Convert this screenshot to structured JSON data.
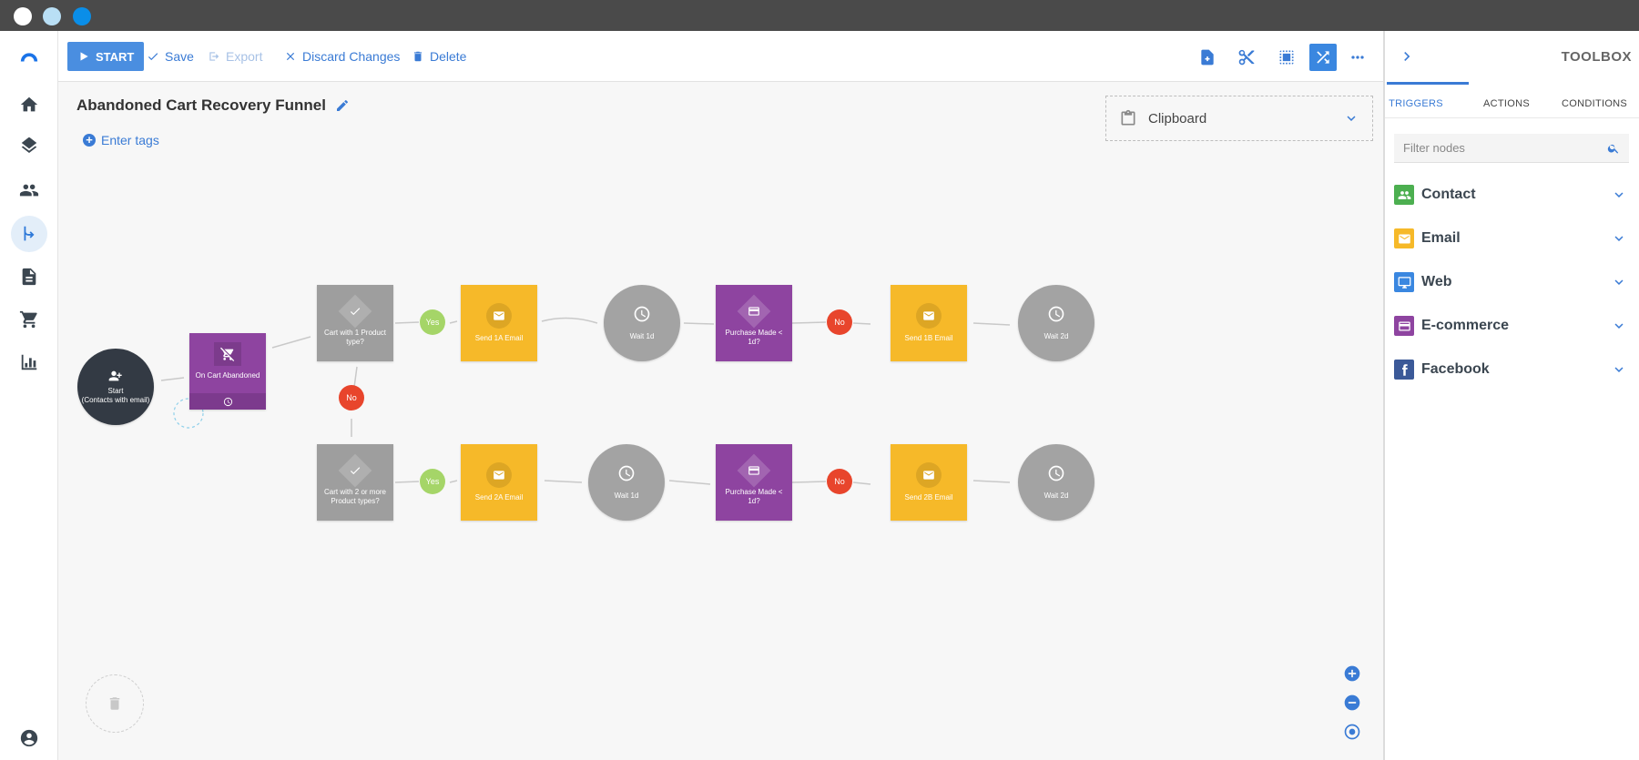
{
  "window": {
    "controls": [
      "close",
      "minimize",
      "maximize"
    ]
  },
  "leftnav": {
    "items": [
      {
        "name": "logo",
        "icon": "logo-icon"
      },
      {
        "name": "home",
        "icon": "home-icon"
      },
      {
        "name": "layers",
        "icon": "layers-icon"
      },
      {
        "name": "contacts",
        "icon": "people-icon"
      },
      {
        "name": "automations",
        "icon": "flow-icon",
        "active": true
      },
      {
        "name": "documents",
        "icon": "document-icon"
      },
      {
        "name": "ecommerce",
        "icon": "cart-icon"
      },
      {
        "name": "reports",
        "icon": "chart-icon"
      },
      {
        "name": "account",
        "icon": "account-icon"
      }
    ]
  },
  "toolbar": {
    "start_label": "START",
    "save_label": "Save",
    "export_label": "Export",
    "discard_label": "Discard Changes",
    "delete_label": "Delete",
    "icons": [
      "add-node-icon",
      "cut-icon",
      "select-area-icon",
      "shuffle-icon",
      "more-icon"
    ]
  },
  "canvas": {
    "title": "Abandoned Cart Recovery Funnel",
    "tags_label": "Enter tags",
    "clipboard_label": "Clipboard",
    "nodes": {
      "start": "Start\n(Contacts with email)",
      "trigger": "On Cart Abandoned",
      "cond1": "Cart with 1 Product type?",
      "cond2": "Cart with 2 or more Product types?",
      "send1a": "Send 1A Email",
      "wait1": "Wait 1d",
      "purchase1": "Purchase Made < 1d?",
      "send1b": "Send 1B Email",
      "wait2": "Wait 2d",
      "send2a": "Send 2A Email",
      "wait3": "Wait 1d",
      "purchase2": "Purchase Made < 1d?",
      "send2b": "Send 2B Email",
      "wait4": "Wait 2d"
    },
    "badges": {
      "yes": "Yes",
      "no": "No"
    }
  },
  "toolbox": {
    "title": "TOOLBOX",
    "tabs": [
      "TRIGGERS",
      "ACTIONS",
      "CONDITIONS"
    ],
    "active_tab": "TRIGGERS",
    "search_placeholder": "Filter nodes",
    "categories": [
      {
        "label": "Contact",
        "color": "#4caf50",
        "icon": "people-icon"
      },
      {
        "label": "Email",
        "color": "#f6b929",
        "icon": "mail-icon"
      },
      {
        "label": "Web",
        "color": "#3a87e0",
        "icon": "monitor-icon"
      },
      {
        "label": "E-commerce",
        "color": "#8e44a0",
        "icon": "card-icon"
      },
      {
        "label": "Facebook",
        "color": "#3b5998",
        "icon": "facebook-icon"
      }
    ]
  },
  "colors": {
    "accent": "#3a7bd5",
    "condition": "#9e9e9e",
    "email": "#f6b929",
    "purchase": "#8e44a0",
    "yes": "#a5d568",
    "no": "#e8452c"
  }
}
